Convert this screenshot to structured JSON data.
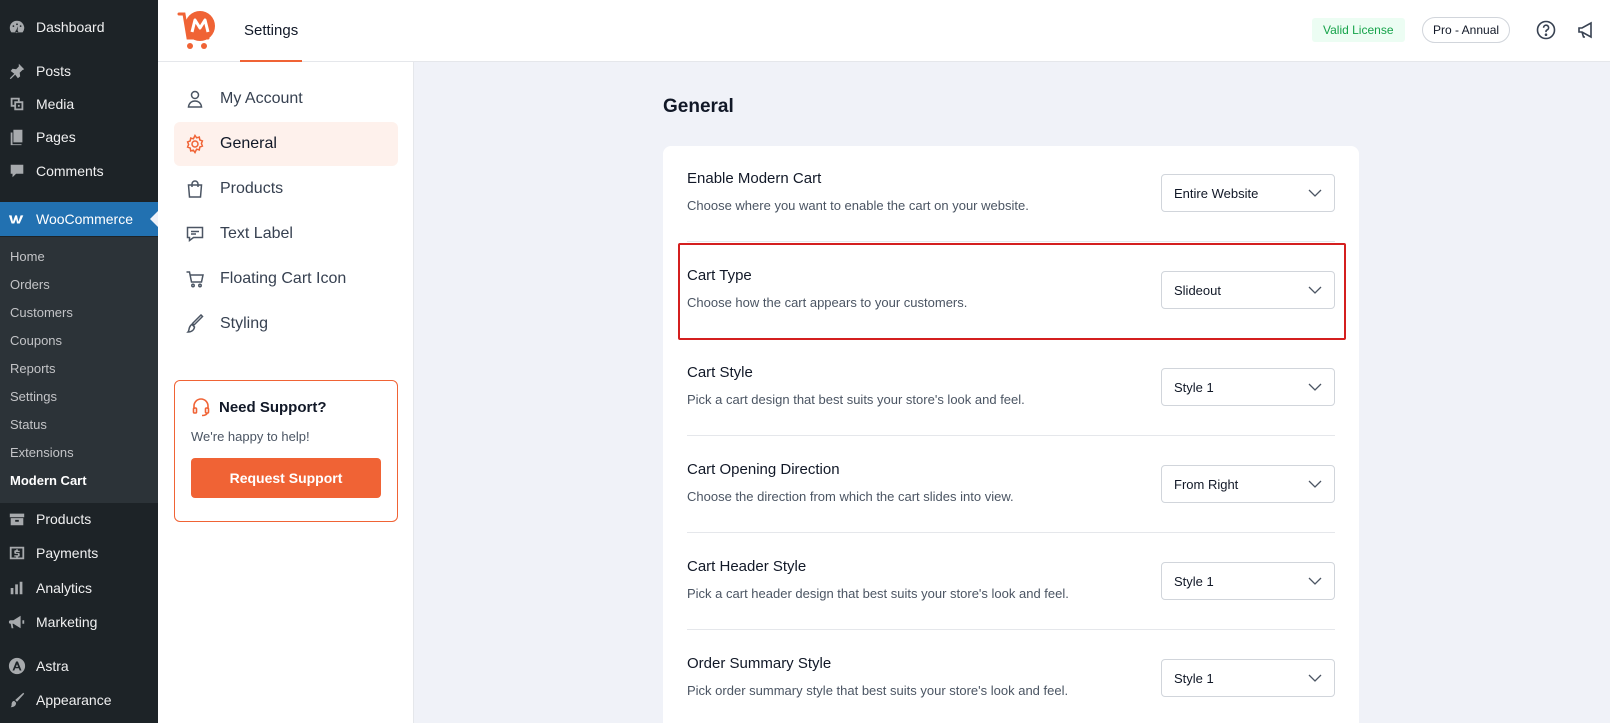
{
  "wp_menu": {
    "items": [
      {
        "label": "Dashboard",
        "icon": "dashboard-icon"
      },
      {
        "label": "Posts",
        "icon": "pin-icon"
      },
      {
        "label": "Media",
        "icon": "media-icon"
      },
      {
        "label": "Pages",
        "icon": "pages-icon"
      },
      {
        "label": "Comments",
        "icon": "comment-icon"
      },
      {
        "label": "WooCommerce",
        "icon": "woo-icon"
      },
      {
        "label": "Products",
        "icon": "archive-icon"
      },
      {
        "label": "Payments",
        "icon": "dollar-icon"
      },
      {
        "label": "Analytics",
        "icon": "bar-chart-icon"
      },
      {
        "label": "Marketing",
        "icon": "megaphone-icon"
      },
      {
        "label": "Astra",
        "icon": "astra-icon"
      },
      {
        "label": "Appearance",
        "icon": "brush-icon"
      }
    ],
    "woo_sub": [
      "Home",
      "Orders",
      "Customers",
      "Coupons",
      "Reports",
      "Settings",
      "Status",
      "Extensions",
      "Modern Cart"
    ]
  },
  "header": {
    "title": "Settings",
    "license": "Valid License",
    "plan": "Pro - Annual",
    "accent": "#f06335"
  },
  "settings_nav": {
    "items": [
      {
        "label": "My Account",
        "icon": "user-icon"
      },
      {
        "label": "General",
        "icon": "gear-icon"
      },
      {
        "label": "Products",
        "icon": "bag-icon"
      },
      {
        "label": "Text Label",
        "icon": "chat-icon"
      },
      {
        "label": "Floating Cart Icon",
        "icon": "cart-icon"
      },
      {
        "label": "Styling",
        "icon": "brush-icon"
      }
    ],
    "support": {
      "title": "Need Support?",
      "text": "We're happy to help!",
      "button": "Request Support"
    }
  },
  "main": {
    "title": "General",
    "rows": [
      {
        "title": "Enable Modern Cart",
        "desc": "Choose where you want to enable the cart on your website.",
        "value": "Entire Website"
      },
      {
        "title": "Cart Type",
        "desc": "Choose how the cart appears to your customers.",
        "value": "Slideout"
      },
      {
        "title": "Cart Style",
        "desc": "Pick a cart design that best suits your store's look and feel.",
        "value": "Style 1"
      },
      {
        "title": "Cart Opening Direction",
        "desc": "Choose the direction from which the cart slides into view.",
        "value": "From Right"
      },
      {
        "title": "Cart Header Style",
        "desc": "Pick a cart header design that best suits your store's look and feel.",
        "value": "Style 1"
      },
      {
        "title": "Order Summary Style",
        "desc": "Pick order summary style that best suits your store's look and feel.",
        "value": "Style 1"
      }
    ]
  }
}
